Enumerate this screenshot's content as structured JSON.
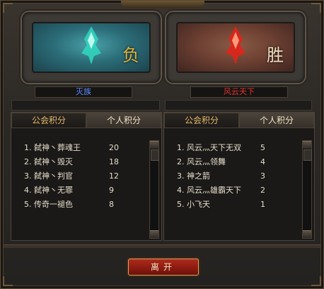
{
  "header": {
    "title": ""
  },
  "left": {
    "result": "负",
    "name": "灭族",
    "name_color": "#5d8cff",
    "tabs": [
      "公会积分",
      "个人积分"
    ],
    "active_tab": 1,
    "rows": [
      {
        "name": "1. 弑神丶葬魂王",
        "score": "20"
      },
      {
        "name": "2. 弑神丶毁灭",
        "score": "18"
      },
      {
        "name": "3. 弑神丶判官",
        "score": "12"
      },
      {
        "name": "4. 弑神丶无罪",
        "score": "9"
      },
      {
        "name": "5. 传奇一褪色",
        "score": "8"
      }
    ]
  },
  "right": {
    "result": "胜",
    "name": "风云天下",
    "name_color": "#e0362b",
    "tabs": [
      "公会积分",
      "个人积分"
    ],
    "active_tab": 1,
    "rows": [
      {
        "name": "1. 风云灬天下无双",
        "score": "5"
      },
      {
        "name": "2. 风云灬领舞",
        "score": "4"
      },
      {
        "name": "3. 神之箭",
        "score": "3"
      },
      {
        "name": "4. 风云灬雄霸天下",
        "score": "2"
      },
      {
        "name": "5. 小飞天",
        "score": "1"
      }
    ]
  },
  "buttons": {
    "leave": "离开"
  },
  "icons": {
    "left_crest": "teal-crest-icon",
    "right_crest": "red-crest-icon"
  }
}
